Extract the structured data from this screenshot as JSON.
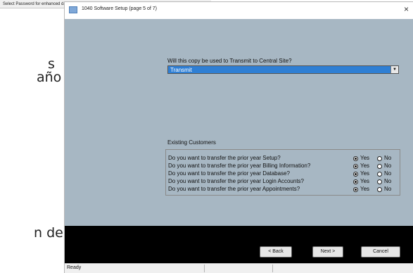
{
  "background": {
    "strip_text": "Select Password for enhanced database encryption",
    "words": [
      "s",
      "año",
      "n de"
    ]
  },
  "dialog": {
    "title": "1040 Software Setup (page 5 of 7)",
    "close_glyph": "×",
    "question": "Will this copy be used to Transmit to Central Site?",
    "select_value": "Transmit",
    "section_label": "Existing Customers",
    "rows": [
      {
        "text": "Do you want to transfer the prior year Setup?",
        "selected": "Yes"
      },
      {
        "text": "Do you want to transfer the prior year Billing Information?",
        "selected": "Yes"
      },
      {
        "text": "Do you want to transfer the prior year Database?",
        "selected": "Yes"
      },
      {
        "text": "Do you want to transfer the prior year Login Accounts?",
        "selected": "Yes"
      },
      {
        "text": "Do you want to transfer the prior year Appointments?",
        "selected": "Yes"
      }
    ],
    "yes_label": "Yes",
    "no_label": "No",
    "buttons": {
      "back": "< Back",
      "next": "Next >",
      "cancel": "Cancel"
    },
    "status": "Ready"
  },
  "colors": {
    "content_bg": "#a7b7c3",
    "select_bg": "#2f7fd4",
    "footer_bg": "#000000"
  },
  "icons": {
    "app": "app-window-icon",
    "close": "close-icon",
    "dropdown": "chevron-down-icon"
  }
}
